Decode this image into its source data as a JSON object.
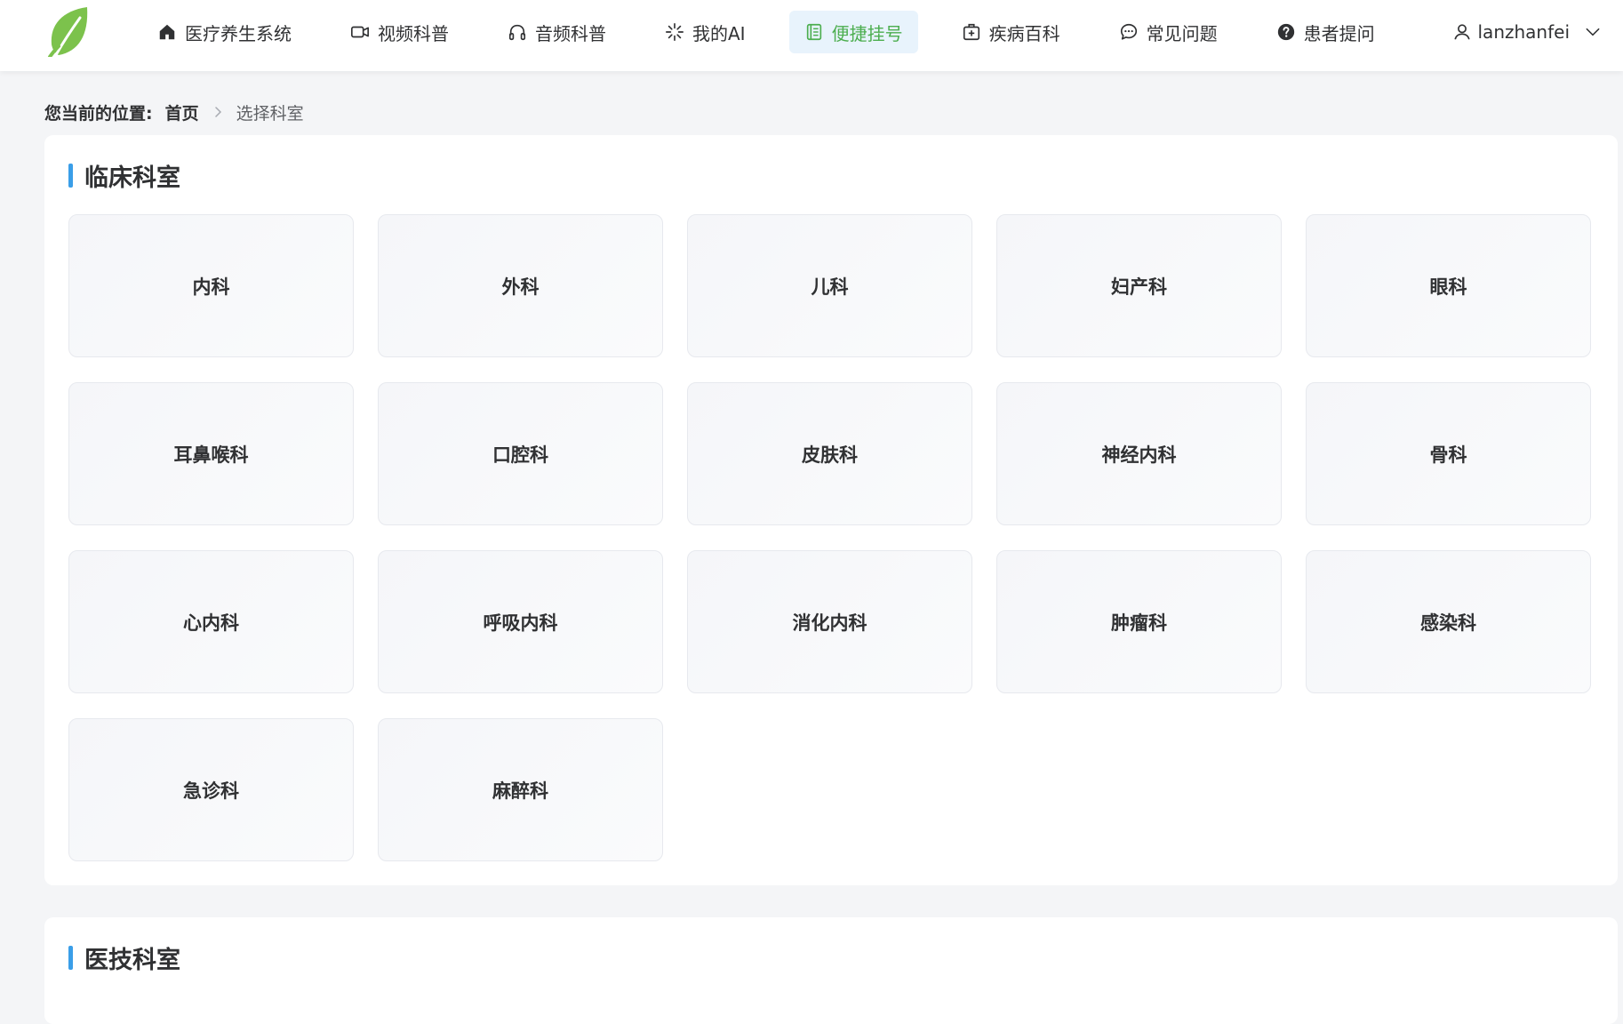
{
  "nav": {
    "items": [
      {
        "label": "医疗养生系统",
        "icon": "home-icon"
      },
      {
        "label": "视频科普",
        "icon": "video-camera-icon"
      },
      {
        "label": "音频科普",
        "icon": "headphones-icon"
      },
      {
        "label": "我的AI",
        "icon": "sparkle-icon"
      },
      {
        "label": "便捷挂号",
        "icon": "notebook-icon",
        "active": true
      },
      {
        "label": "疾病百科",
        "icon": "medical-kit-icon"
      },
      {
        "label": "常见问题",
        "icon": "chat-bubble-icon"
      },
      {
        "label": "患者提问",
        "icon": "question-circle-icon"
      }
    ],
    "active_color": "#4cae4f",
    "active_bg": "#e8f3fc"
  },
  "user": {
    "name": "lanzhanfei"
  },
  "breadcrumb": {
    "prefix": "您当前的位置:",
    "home": "首页",
    "current": "选择科室"
  },
  "sections": {
    "clinical": {
      "title": "临床科室",
      "departments": [
        "内科",
        "外科",
        "儿科",
        "妇产科",
        "眼科",
        "耳鼻喉科",
        "口腔科",
        "皮肤科",
        "神经内科",
        "骨科",
        "心内科",
        "呼吸内科",
        "消化内科",
        "肿瘤科",
        "感染科",
        "急诊科",
        "麻醉科"
      ]
    },
    "technical": {
      "title": "医技科室"
    }
  },
  "colors": {
    "accent_bar": "#3a9ee8",
    "logo_green": "#7cc24c"
  }
}
